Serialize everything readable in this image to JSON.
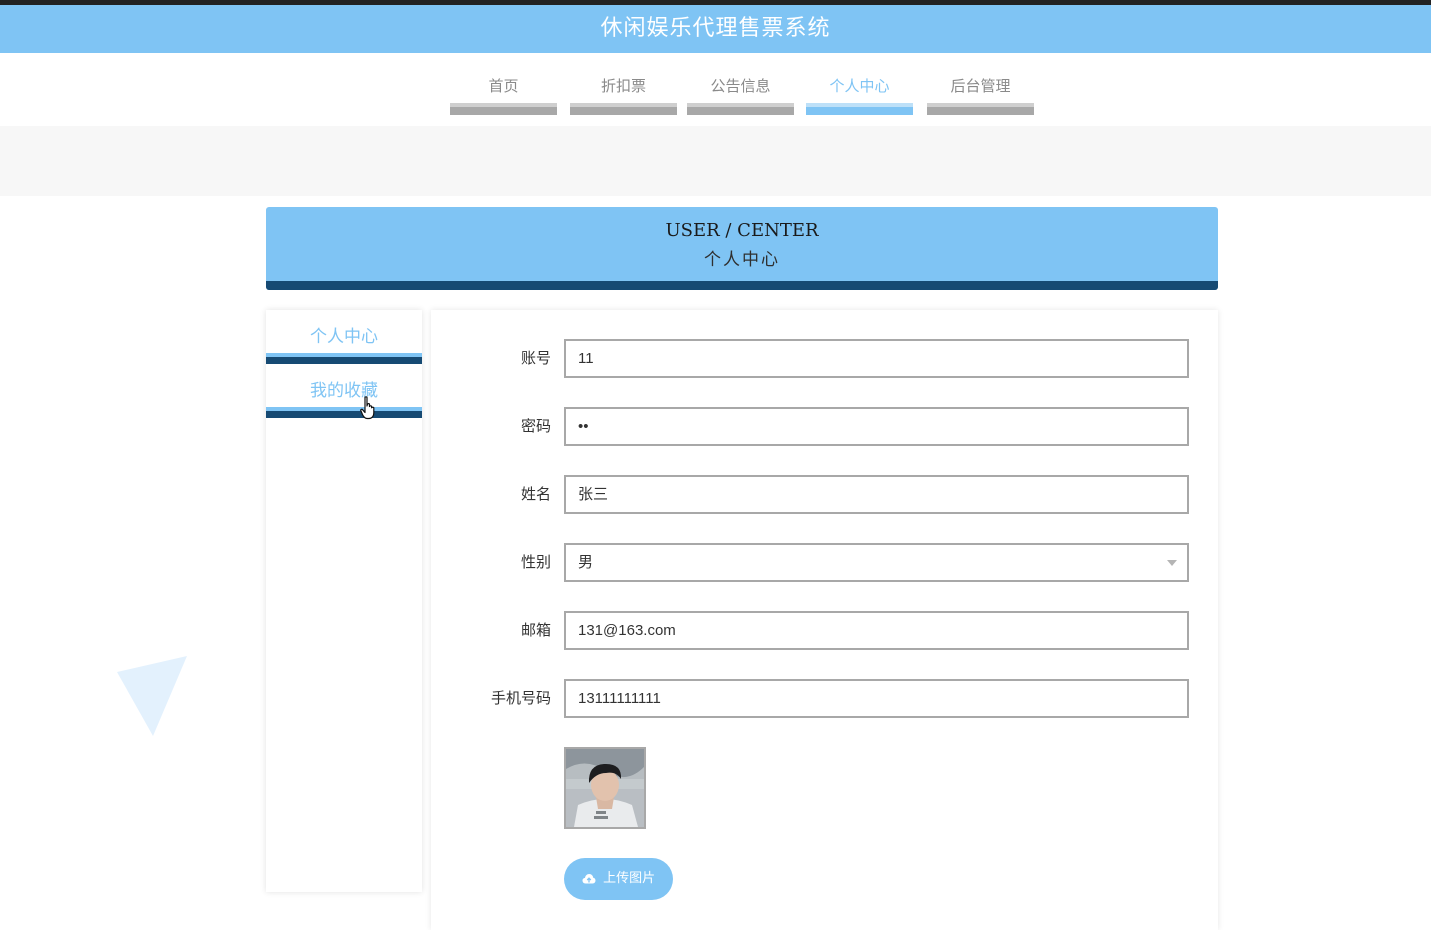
{
  "header": {
    "title": "休闲娱乐代理售票系统"
  },
  "nav": {
    "items": [
      {
        "label": "首页",
        "active": false
      },
      {
        "label": "折扣票",
        "active": false
      },
      {
        "label": "公告信息",
        "active": false
      },
      {
        "label": "个人中心",
        "active": true
      },
      {
        "label": "后台管理",
        "active": false
      }
    ]
  },
  "banner": {
    "title_en": "USER / CENTER",
    "title_cn": "个人中心"
  },
  "sidebar": {
    "items": [
      {
        "label": "个人中心"
      },
      {
        "label": "我的收藏"
      }
    ]
  },
  "form": {
    "account": {
      "label": "账号",
      "value": "11"
    },
    "password": {
      "label": "密码",
      "value": "••"
    },
    "name": {
      "label": "姓名",
      "value": "张三"
    },
    "gender": {
      "label": "性别",
      "value": "男"
    },
    "email": {
      "label": "邮箱",
      "value": "131@163.com"
    },
    "phone": {
      "label": "手机号码",
      "value": "13111111111"
    },
    "upload_label": "上传图片"
  },
  "colors": {
    "accent": "#7fc4f4",
    "dark": "#164a73",
    "nav_inactive": "#a8a8a8"
  },
  "icons": {
    "upload": "cloud-upload-icon",
    "cursor": "hand-pointer-icon",
    "select": "chevron-down-icon"
  }
}
